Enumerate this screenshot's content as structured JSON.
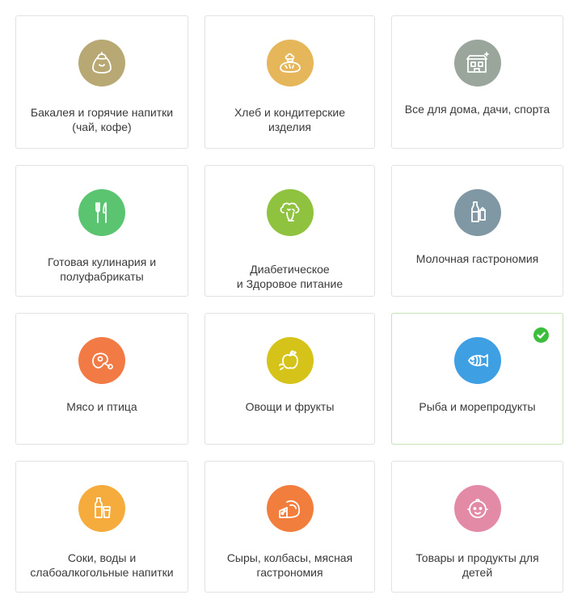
{
  "categories": [
    {
      "label": "Бакалея и горячие напитки\n(чай, кофе)",
      "icon": "sack-icon",
      "color": "#b7a874"
    },
    {
      "label": "Хлеб и кондитерские\nизделия",
      "icon": "bread-icon",
      "color": "#e5b75a"
    },
    {
      "label": "Все для дома, дачи, спорта",
      "icon": "house-icon",
      "color": "#9aa59c"
    },
    {
      "label": "Готовая кулинария и\nполуфабрикаты",
      "icon": "cutlery-icon",
      "color": "#5bc471"
    },
    {
      "label": "Диабетическое\nи Здоровое питание",
      "icon": "broccoli-icon",
      "color": "#8fc23f"
    },
    {
      "label": "Молочная гастрономия",
      "icon": "milk-icon",
      "color": "#7f98a3"
    },
    {
      "label": "Мясо и птица",
      "icon": "meat-icon",
      "color": "#f27a44"
    },
    {
      "label": "Овощи и фрукты",
      "icon": "apple-icon",
      "color": "#d6c31a"
    },
    {
      "label": "Рыба и морепродукты",
      "icon": "fish-icon",
      "color": "#3f9fe3",
      "selected": true
    },
    {
      "label": "Соки, воды и\nслабоалкогольные напитки",
      "icon": "bottle-glass-icon",
      "color": "#f5ac3c"
    },
    {
      "label": "Сыры, колбасы, мясная\nгастрономия",
      "icon": "cheese-sausage-icon",
      "color": "#f27e3e"
    },
    {
      "label": "Товары и продукты для\nдетей",
      "icon": "baby-icon",
      "color": "#e38aa6"
    }
  ],
  "selected_check_color": "#3cbe3c"
}
